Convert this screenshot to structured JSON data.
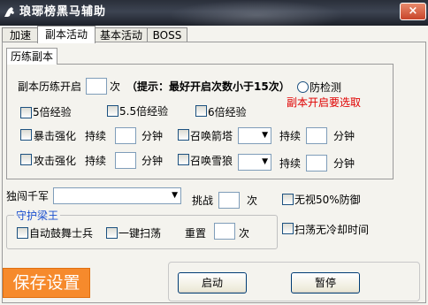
{
  "window": {
    "title": "琅琊榜黑马辅助",
    "close_label": "×"
  },
  "tabs": [
    "加速",
    "副本活动",
    "基本活动",
    "BOSS"
  ],
  "active_tab": "副本活动",
  "subtab": "历练副本",
  "dungeon": {
    "open_label": "副本历练开启",
    "open_unit": "次",
    "hint": "（提示：最好开启次数小于15次）",
    "anti_detect": "防检测",
    "must_select": "副本开启要选取",
    "exp_options": [
      "5倍经验",
      "5.5倍经验",
      "6倍经验"
    ],
    "crit_label": "暴击强化",
    "attack_label": "攻击强化",
    "duration_label": "持续",
    "minute_label": "分钟",
    "summon_arrow": "召唤箭塔",
    "summon_wolf": "召唤雪狼"
  },
  "solo": {
    "label": "独闯千军",
    "challenge_label": "挑战",
    "unit": "次"
  },
  "ignore_defense": "无视50%防御",
  "no_cooldown": "扫荡无冷却时间",
  "guard": {
    "title": "守护梁王",
    "auto_drum": "自动鼓舞士兵",
    "one_key_sweep": "一键扫荡",
    "reset_label": "重置",
    "unit": "次"
  },
  "buttons": {
    "save": "保存设置",
    "start": "启动",
    "pause": "暂停"
  },
  "colors": {
    "save_bg": "#f68a2c",
    "warning": "#e00000",
    "group_title": "#1a4fcf"
  }
}
